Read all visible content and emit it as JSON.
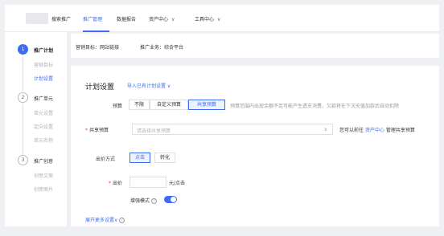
{
  "header": {
    "prefix": "搜索推广",
    "nav": [
      {
        "label": "推广管理",
        "active": true
      },
      {
        "label": "数据报告"
      },
      {
        "label": "资产中心"
      },
      {
        "label": "工具中心"
      }
    ],
    "chevron": "∨"
  },
  "sidebar": {
    "steps": [
      {
        "num": "1",
        "title": "推广计划",
        "subs": [
          "营销目标",
          "计划设置"
        ]
      },
      {
        "num": "2",
        "title": "推广单元",
        "subs": [
          "单元设置",
          "定向设置",
          "单元名称"
        ]
      },
      {
        "num": "3",
        "title": "推广创意",
        "subs": [
          "创意文案",
          "创意图片"
        ]
      }
    ]
  },
  "info": {
    "goal": "营销目标：网站链接",
    "business": "推广业务：综合平台"
  },
  "plan": {
    "title": "计划设置",
    "import_link": "导入已有计划设置 ∨",
    "budget": {
      "label": "预算",
      "options": [
        "不限",
        "自定义预算",
        "共享预算"
      ],
      "selected": "共享预算",
      "hint": "预算范围内出现余额不足可能产生透支消费，欠款将在下次充值加款后自动扣除"
    },
    "shared_budget": {
      "label": "共享预算",
      "placeholder": "请选择共享预算",
      "arrow": "∨",
      "tail_text": "您可以前往",
      "tail_link": "资产中心",
      "tail_suffix": "管理共享预算"
    },
    "bidding": {
      "label": "出价方式",
      "options": [
        "点击",
        "转化"
      ],
      "selected": "点击"
    },
    "bid": {
      "label": "出价",
      "value": "",
      "unit": "元/点击"
    },
    "enhanced": {
      "label": "增强模式",
      "help": "?",
      "enabled": true
    },
    "expand": "展开更多设置",
    "expand_arrow": "∨",
    "expand_help": "?"
  },
  "colors": {
    "accent": "#3b6cf6",
    "required": "#e33333"
  }
}
